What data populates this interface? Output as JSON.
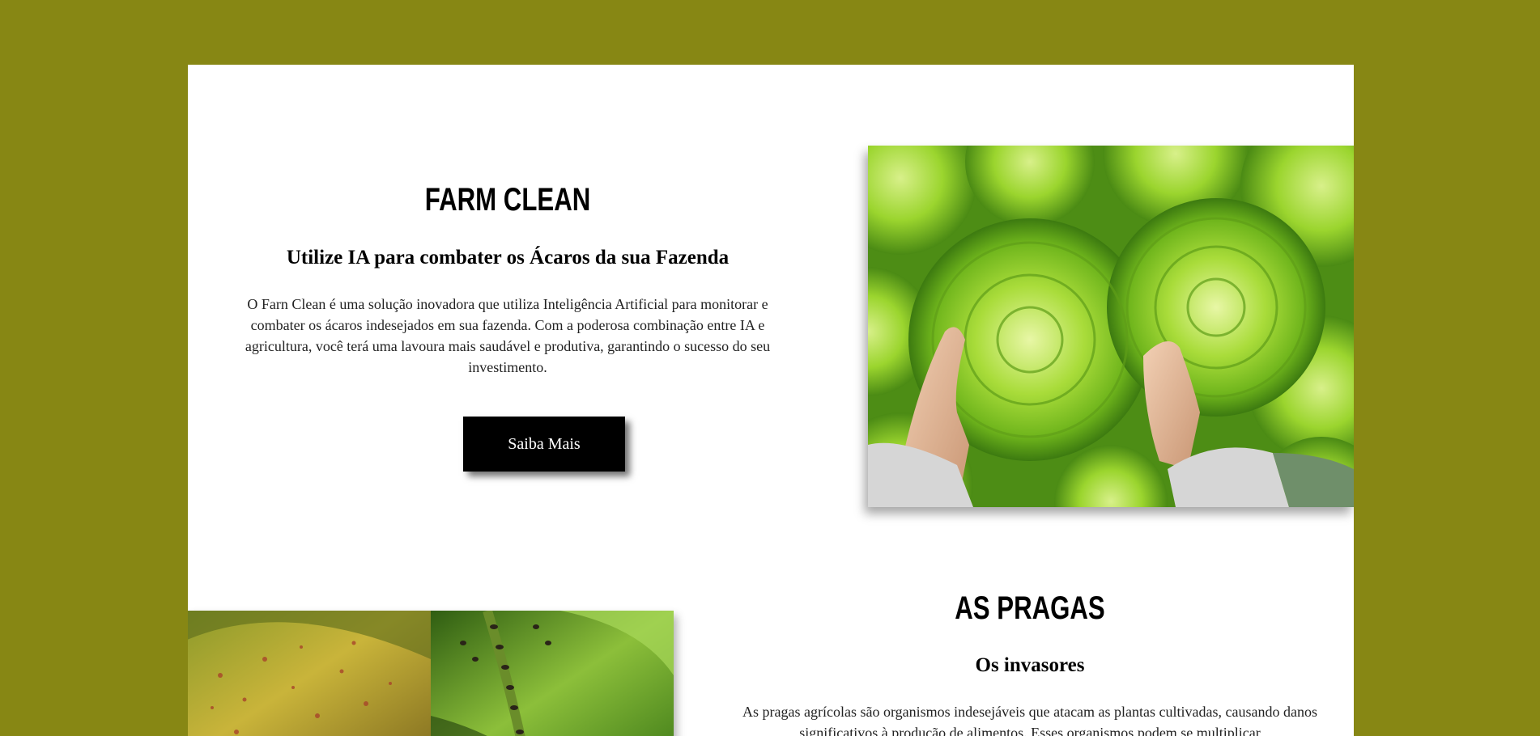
{
  "hero": {
    "title": "FARM CLEAN",
    "subtitle": "Utilize IA para combater os Ácaros da sua Fazenda",
    "paragraph": "O Farn Clean é uma solução inovadora que utiliza Inteligência Artificial para monitorar e combater os ácaros indesejados em sua fazenda. Com a poderosa combinação entre IA e agricultura, você terá uma lavoura mais saudável e produtiva, garantindo o sucesso do seu investimento.",
    "button_label": "Saiba Mais"
  },
  "pests": {
    "title": "AS PRAGAS",
    "subtitle": "Os invasores",
    "paragraph": "As pragas agrícolas são organismos indesejáveis que atacam as plantas cultivadas, causando danos significativos à produção de alimentos. Esses organismos podem se multiplicar"
  },
  "colors": {
    "page_background": "#878714",
    "card_background": "#ffffff",
    "button_background": "#000000",
    "button_text": "#ffffff"
  }
}
